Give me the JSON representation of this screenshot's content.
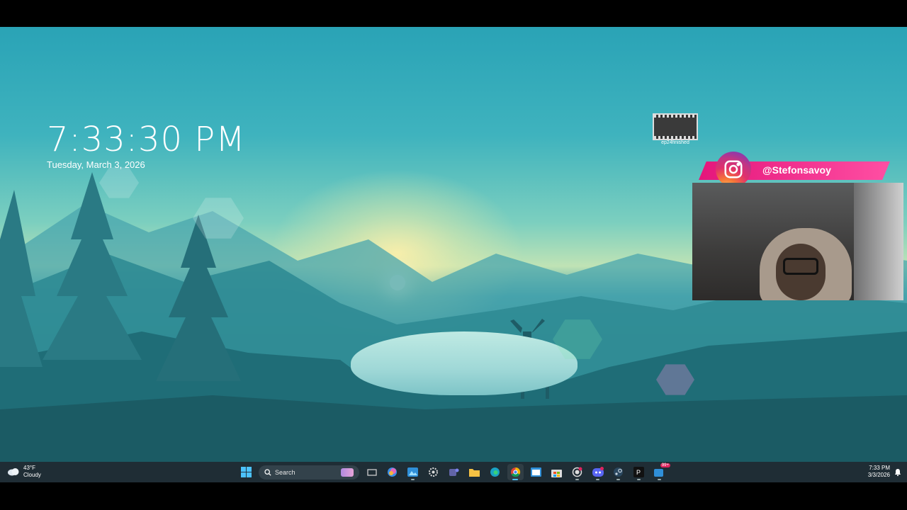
{
  "desktop": {
    "clock_time": "7:33:30 PM",
    "clock_date": "Tuesday, March 3, 2026",
    "icon_label": "ep24finished"
  },
  "overlay": {
    "instagram_handle": "@Stefonsavoy"
  },
  "taskbar": {
    "weather_temp": "43°F",
    "weather_condition": "Cloudy",
    "search_label": "Search",
    "apps": [
      {
        "name": "task-view-icon"
      },
      {
        "name": "copilot-icon"
      },
      {
        "name": "photos-icon"
      },
      {
        "name": "gear-app-icon"
      },
      {
        "name": "teams-icon"
      },
      {
        "name": "file-explorer-icon"
      },
      {
        "name": "edge-icon"
      },
      {
        "name": "chrome-icon"
      },
      {
        "name": "app-window-icon"
      },
      {
        "name": "store-icon"
      },
      {
        "name": "record-app-icon"
      },
      {
        "name": "discord-icon"
      },
      {
        "name": "steam-icon"
      },
      {
        "name": "terminal-app-icon"
      },
      {
        "name": "notifications-app-icon"
      }
    ],
    "notification_badge": "99+",
    "tray_time": "7:33 PM",
    "tray_date": "3/3/2026"
  },
  "colors": {
    "taskbar_bg": "#1f2d35",
    "instagram_pink": "#e4167b"
  }
}
